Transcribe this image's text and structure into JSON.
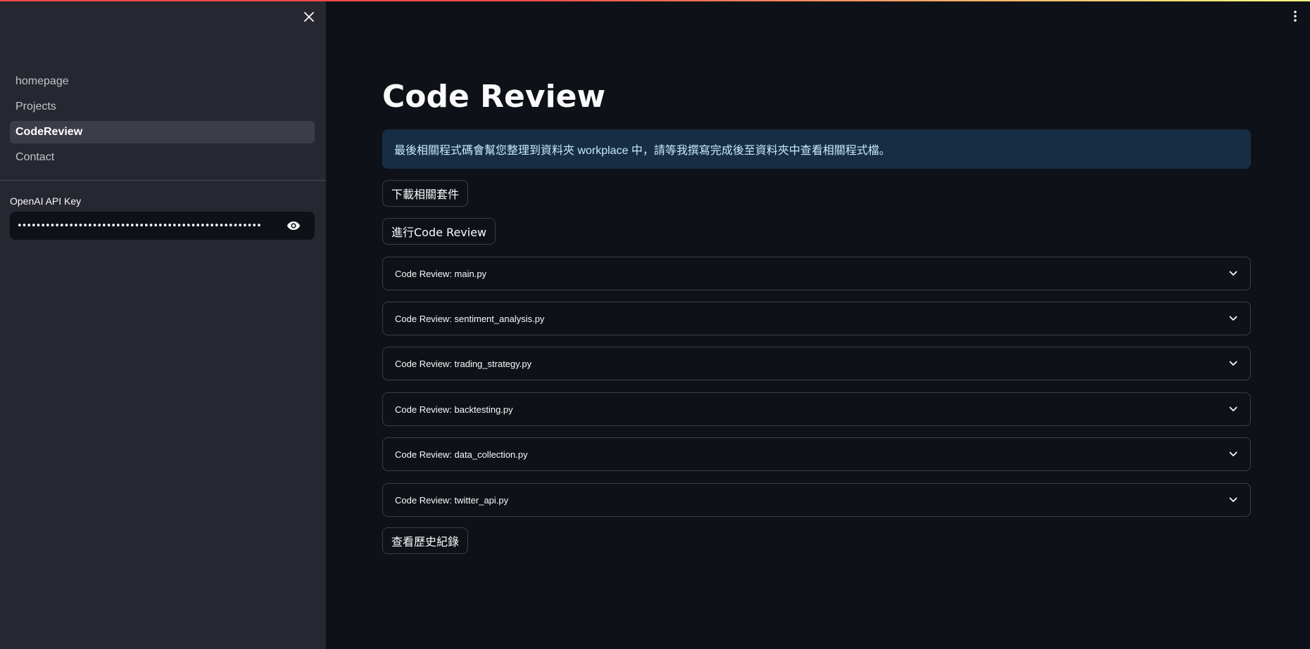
{
  "sidebar": {
    "nav_items": [
      {
        "label": "homepage",
        "active": false
      },
      {
        "label": "Projects",
        "active": false
      },
      {
        "label": "CodeReview",
        "active": true
      },
      {
        "label": "Contact",
        "active": false
      }
    ],
    "api_key_label": "OpenAI API Key",
    "api_key_value": "••••••••••••••••••••••••••••••••••••••••••••••••••••"
  },
  "main": {
    "title": "Code Review",
    "info_text": "最後相關程式碼會幫您整理到資料夾 workplace 中，請等我撰寫完成後至資料夾中查看相關程式檔。",
    "download_button": "下載相關套件",
    "run_button": "進行Code Review",
    "expanders": [
      "Code Review: main.py",
      "Code Review: sentiment_analysis.py",
      "Code Review: trading_strategy.py",
      "Code Review: backtesting.py",
      "Code Review: data_collection.py",
      "Code Review: twitter_api.py"
    ],
    "history_button": "查看歷史紀錄"
  },
  "colors": {
    "background": "#0e1117",
    "sidebar": "#262730",
    "info_bg": "#172d43",
    "info_text": "#c7ebff",
    "accent_top": "#ff4b4b"
  }
}
